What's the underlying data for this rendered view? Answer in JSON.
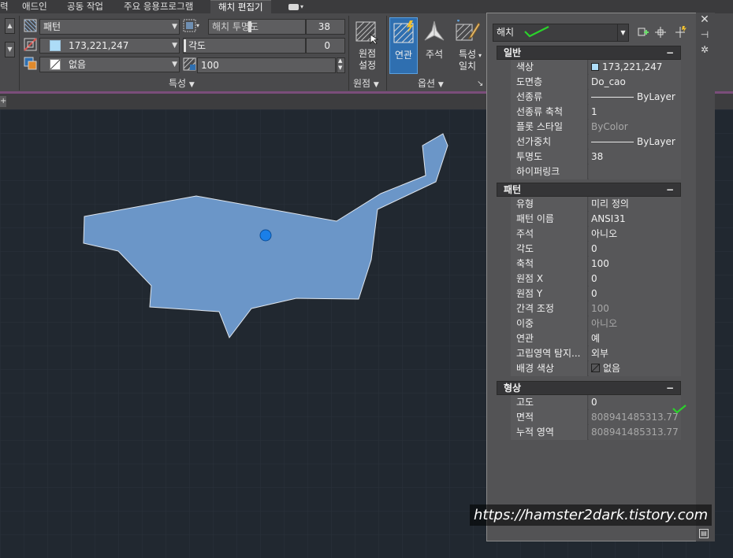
{
  "colors": {
    "accent": "#2f6fb0",
    "canvas_bg": "#212830",
    "hatch_fill": "#6b96c8",
    "grip": "#1a7fe8",
    "check_green": "#2bd12b"
  },
  "menu": {
    "tabs": [
      "력",
      "애드인",
      "공동 작업",
      "주요 응용프로그램",
      "해치 편집기"
    ],
    "active_tab": "해치 편집기"
  },
  "ribbon": {
    "pattern_type": "패턴",
    "transparency_label": "해치 투명도",
    "transparency_value": "38",
    "color_value": "173,221,247",
    "angle_label": "각도",
    "angle_value": "0",
    "background_value": "없음",
    "scale_value": "100",
    "panel_properties": "특성",
    "origin_set_l1": "원점",
    "origin_set_l2": "설정",
    "panel_origin": "원점",
    "associative": "연관",
    "annotative": "주석",
    "match_l1": "특성",
    "match_l2": "일치",
    "panel_options": "옵션"
  },
  "palette": {
    "selection": "해치",
    "sections": {
      "general": "일반",
      "pattern": "패턴",
      "geometry": "형상"
    },
    "collapse_symbol": "−",
    "general_rows": [
      {
        "k": "색상",
        "v": "173,221,247"
      },
      {
        "k": "도면층",
        "v": "Do_cao"
      },
      {
        "k": "선종류",
        "v": "ByLayer"
      },
      {
        "k": "선종류 축척",
        "v": "1"
      },
      {
        "k": "플롯 스타일",
        "v": "ByColor"
      },
      {
        "k": "선가중치",
        "v": "ByLayer"
      },
      {
        "k": "투명도",
        "v": "38"
      },
      {
        "k": "하이퍼링크",
        "v": ""
      }
    ],
    "pattern_rows": [
      {
        "k": "유형",
        "v": "미리 정의"
      },
      {
        "k": "패턴 이름",
        "v": "ANSI31"
      },
      {
        "k": "주석",
        "v": "아니오"
      },
      {
        "k": "각도",
        "v": "0"
      },
      {
        "k": "축척",
        "v": "100"
      },
      {
        "k": "원점 X",
        "v": "0"
      },
      {
        "k": "원점 Y",
        "v": "0"
      },
      {
        "k": "간격 조정",
        "v": "100"
      },
      {
        "k": "이중",
        "v": "아니오"
      },
      {
        "k": "연관",
        "v": "예"
      },
      {
        "k": "고립영역 탐지...",
        "v": "외부"
      },
      {
        "k": "배경 색상",
        "v": "없음"
      }
    ],
    "geometry_rows": [
      {
        "k": "고도",
        "v": "0"
      },
      {
        "k": "면적",
        "v": "808941485313.77"
      },
      {
        "k": "누적 영역",
        "v": "808941485313.77"
      }
    ]
  },
  "watermark": "https://hamster2dark.tistory.com"
}
